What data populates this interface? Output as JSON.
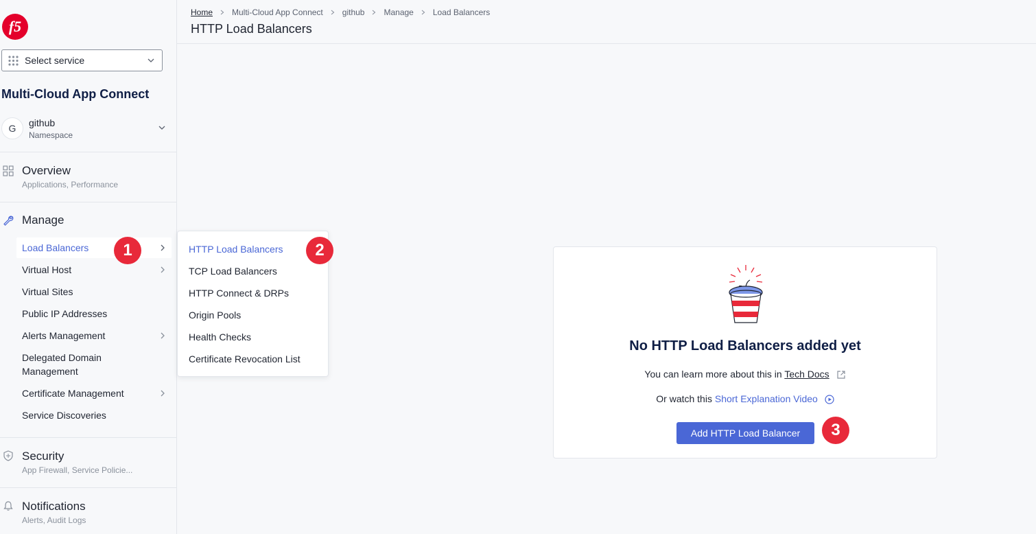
{
  "app": {
    "logo": "f5",
    "select_service": "Select service",
    "title": "Multi-Cloud App Connect",
    "namespace": {
      "initial": "G",
      "name": "github",
      "label": "Namespace"
    }
  },
  "sidebar": {
    "overview": {
      "title": "Overview",
      "subtitle": "Applications, Performance",
      "icon": "grid-icon"
    },
    "manage": {
      "title": "Manage",
      "icon": "wrench-icon",
      "items": [
        {
          "label": "Load Balancers",
          "has_submenu": true,
          "active": true
        },
        {
          "label": "Virtual Host",
          "has_submenu": true
        },
        {
          "label": "Virtual Sites",
          "has_submenu": false
        },
        {
          "label": "Public IP Addresses",
          "has_submenu": false
        },
        {
          "label": "Alerts Management",
          "has_submenu": true
        },
        {
          "label": "Delegated Domain Management",
          "has_submenu": false
        },
        {
          "label": "Certificate Management",
          "has_submenu": true
        },
        {
          "label": "Service Discoveries",
          "has_submenu": false
        }
      ]
    },
    "security": {
      "title": "Security",
      "subtitle": "App Firewall, Service Policie...",
      "icon": "shield-icon"
    },
    "notifications": {
      "title": "Notifications",
      "subtitle": "Alerts, Audit Logs",
      "icon": "bell-icon"
    }
  },
  "flyout": {
    "items": [
      {
        "label": "HTTP Load Balancers",
        "active": true
      },
      {
        "label": "TCP Load Balancers"
      },
      {
        "label": "HTTP Connect & DRPs"
      },
      {
        "label": "Origin Pools"
      },
      {
        "label": "Health Checks"
      },
      {
        "label": "Certificate Revocation List"
      }
    ]
  },
  "header": {
    "breadcrumb": [
      "Home",
      "Multi-Cloud App Connect",
      "github",
      "Manage",
      "Load Balancers"
    ],
    "title": "HTTP Load Balancers"
  },
  "empty_state": {
    "heading": "No HTTP Load Balancers added yet",
    "learn_prefix": "You can learn more about this in",
    "learn_link": "Tech Docs",
    "watch_prefix": "Or watch this",
    "watch_link": "Short Explanation Video",
    "button": "Add HTTP Load Balancer"
  },
  "callouts": [
    "1",
    "2",
    "3"
  ],
  "colors": {
    "accent": "#4a67d6",
    "callout": "#e8293a",
    "logo": "#e4002b"
  }
}
